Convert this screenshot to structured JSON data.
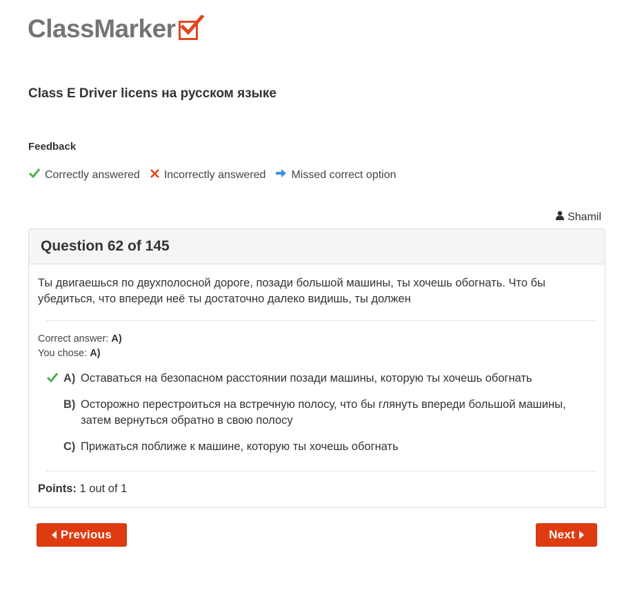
{
  "header": {
    "logo_text": "ClassMarker",
    "test_title": "Class E Driver licens на русском языке"
  },
  "feedback": {
    "heading": "Feedback",
    "legend": [
      {
        "icon": "check-icon",
        "label": "Correctly answered",
        "color": "#4caf50"
      },
      {
        "icon": "cross-icon",
        "label": "Incorrectly answered",
        "color": "#e2461d"
      },
      {
        "icon": "arrow-right-icon",
        "label": "Missed correct option",
        "color": "#3d8fe0"
      }
    ]
  },
  "user": {
    "icon": "user-icon",
    "name": "Shamil"
  },
  "question": {
    "title": "Question 62 of 145",
    "text": "Ты двигаешься по двухполосной дороге, позади большой машины, ты хочешь обогнать. Что бы убедиться, что впереди неё ты достаточно далеко видишь, ты должен",
    "correct_answer_label": "Correct answer:",
    "correct_answer_value": "A)",
    "you_chose_label": "You chose:",
    "you_chose_value": "A)",
    "options": [
      {
        "letter": "A)",
        "text": "Оставаться на безопасном расстоянии позади машины, которую ты хочешь обогнать",
        "status": "correct"
      },
      {
        "letter": "B)",
        "text": "Осторожно перестроиться на встречную полосу, что бы глянуть впереди большой машины, затем вернуться обратно в свою полосу",
        "status": "none"
      },
      {
        "letter": "C)",
        "text": "Прижаться поближе к машине, которую ты хочешь обогнать",
        "status": "none"
      }
    ],
    "points_label": "Points:",
    "points_value": "1 out of 1"
  },
  "navigation": {
    "previous_label": "Previous",
    "next_label": "Next",
    "button_color": "#df3b10"
  }
}
